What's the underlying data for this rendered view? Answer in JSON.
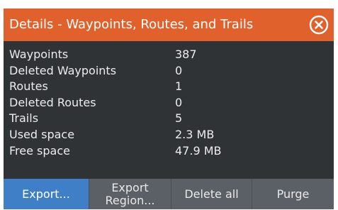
{
  "dialog": {
    "title": "Details - Waypoints, Routes, and Trails",
    "close_icon": "close-circle-icon"
  },
  "details": [
    {
      "label": "Waypoints",
      "value": "387"
    },
    {
      "label": "Deleted Waypoints",
      "value": "0"
    },
    {
      "label": "Routes",
      "value": "1"
    },
    {
      "label": "Deleted Routes",
      "value": "0"
    },
    {
      "label": "Trails",
      "value": "5"
    },
    {
      "label": "Used space",
      "value": "2.3 MB"
    },
    {
      "label": "Free space",
      "value": "47.9 MB"
    }
  ],
  "buttons": {
    "export": "Export...",
    "export_region_line1": "Export",
    "export_region_line2": "Region...",
    "delete_all": "Delete all",
    "purge": "Purge"
  },
  "colors": {
    "titlebar": "#e0612c",
    "panel": "#2f3336",
    "button": "#5a6066",
    "active_button": "#3f7fc8"
  }
}
